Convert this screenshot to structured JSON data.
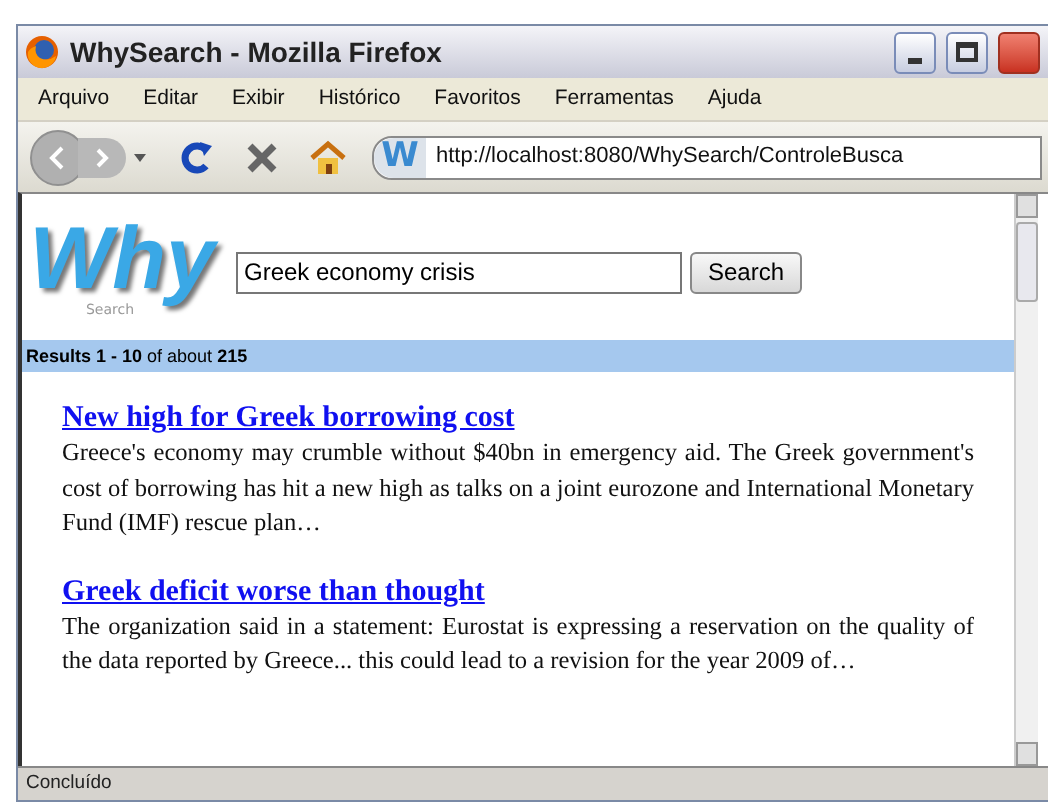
{
  "window": {
    "title": "WhySearch - Mozilla Firefox"
  },
  "menu": [
    "Arquivo",
    "Editar",
    "Exibir",
    "Histórico",
    "Favoritos",
    "Ferramentas",
    "Ajuda"
  ],
  "address_bar": {
    "site_icon": "W",
    "value": "http://localhost:8080/WhySearch/ControleBusca"
  },
  "logo": {
    "title": "Why",
    "subtitle": "Search"
  },
  "search": {
    "value": "Greek economy crisis",
    "button": "Search"
  },
  "results_summary": "**Results 1 - 10** of about **215**",
  "results": [
    {
      "title": "New high for Greek borrowing cost",
      "snippet": "Greece's economy may crumble without $40bn in emergency aid. The Greek government's cost of borrowing has hit a new high as talks on a joint eurozone and International Monetary Fund (IMF) rescue plan…"
    },
    {
      "title": "Greek deficit worse than thought",
      "snippet": "The organization said in a statement: Eurostat is expressing a reservation on the quality of the data reported by Greece... this could lead to a revision for the year 2009 of…"
    }
  ],
  "status_bar": "Concluído"
}
